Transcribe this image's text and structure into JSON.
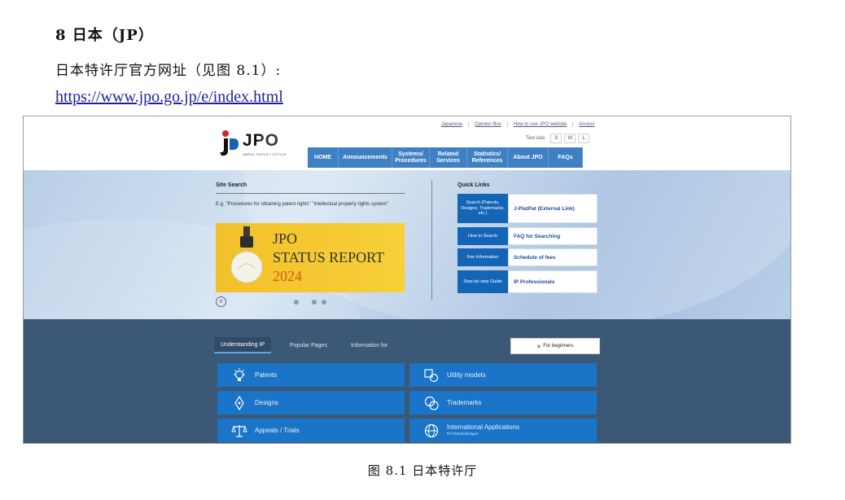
{
  "doc": {
    "heading": "8 日本（JP）",
    "line": "日本特许厅官方网址（见图 8.1）:",
    "url": "https://www.jpo.go.jp/e/index.html",
    "caption": "图 8.1 日本特许厅"
  },
  "jpo": {
    "logo_text": "JPO",
    "logo_sub": "JAPAN PATENT OFFICE",
    "top_links": [
      "Japanese",
      "Opinion Box",
      "How to use JPO website",
      "Access"
    ],
    "text_size_label": "Text size",
    "text_sizes": [
      "S",
      "M",
      "L"
    ],
    "nav": [
      "HOME",
      "Announcements",
      "Systems/ Procedures",
      "Related Services",
      "Statistics/ References",
      "About JPO",
      "FAQs"
    ],
    "site_search_title": "Site Search",
    "site_search_example": "E.g. \"Procedures for obtaining patent rights\" \"Intellectual property rights system\"",
    "banner": {
      "line1": "JPO",
      "line2": "STATUS REPORT",
      "line3": "2024"
    },
    "pause_symbol": "II",
    "quick_links_title": "Quick Links",
    "quick_links": [
      {
        "left": "Search (Patents, Designs, Trademarks, etc.)",
        "right": "J-PlatPat (External Link)"
      },
      {
        "left": "How to Search",
        "right": "FAQ for Searching"
      },
      {
        "left": "Fee Information",
        "right": "Schedule of fees"
      },
      {
        "left": "Step-by-step Guide",
        "right": "IP Professionals"
      }
    ],
    "tabs": [
      "Understanding IP",
      "Popular Pages",
      "Information for"
    ],
    "beginners": "For beginners",
    "tiles": [
      {
        "label": "Patents",
        "icon": "lightbulb-icon"
      },
      {
        "label": "Utility models",
        "icon": "utility-model-icon"
      },
      {
        "label": "Designs",
        "icon": "pen-nib-icon"
      },
      {
        "label": "Trademarks",
        "icon": "trademark-icon"
      },
      {
        "label": "Appeals / Trials",
        "icon": "scales-icon"
      },
      {
        "label": "International Applications",
        "sub": "PCT/Madrid/Hague",
        "icon": "globe-icon"
      }
    ],
    "colors": {
      "nav_blue": "#1565b7",
      "tile_blue": "#1a74c8",
      "lower_bg": "#3b5876",
      "banner_yellow": "#f2c02a"
    }
  }
}
